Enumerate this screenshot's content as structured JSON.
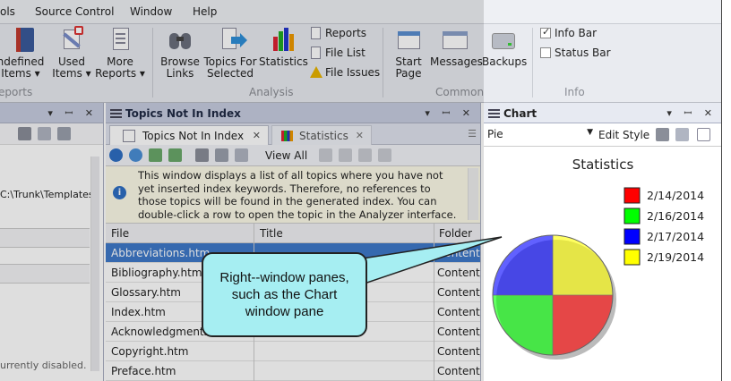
{
  "menubar": {
    "items": [
      "ols",
      "Source Control",
      "Window",
      "Help"
    ]
  },
  "ribbon": {
    "buttons": [
      {
        "line1": "ndefined",
        "line2": "Items ▾"
      },
      {
        "line1": "Used",
        "line2": "Items ▾"
      },
      {
        "line1": "More",
        "line2": "Reports ▾"
      },
      {
        "line1": "Browse",
        "line2": "Links"
      },
      {
        "line1": "Topics For",
        "line2": "Selected"
      },
      {
        "line1": "Statistics",
        "line2": ""
      },
      {
        "line1": "Start",
        "line2": "Page"
      },
      {
        "line1": "Messages",
        "line2": ""
      },
      {
        "line1": "Backups",
        "line2": ""
      }
    ],
    "small_items": [
      "Reports",
      "File List",
      "File Issues"
    ],
    "checkboxes": [
      {
        "label": "Info Bar",
        "checked": true
      },
      {
        "label": "Status Bar",
        "checked": false
      }
    ],
    "groups": [
      "eports",
      "Analysis",
      "Common",
      "Info"
    ]
  },
  "left_pane": {
    "path": "C:\\Trunk\\Templates\\",
    "status": "urrently disabled."
  },
  "topics_pane": {
    "title": "Topics Not In Index",
    "tabs": [
      {
        "label": "Topics Not In Index"
      },
      {
        "label": "Statistics"
      }
    ],
    "view_all": "View All",
    "info_text": "This window displays a list of all topics where you have not yet inserted index keywords. Therefore, no references to those topics will be found in the generated index. You can double-click a row to open the topic in the Analyzer interface. You can also select the row",
    "columns": [
      "File",
      "Title",
      "Folder"
    ],
    "rows": [
      {
        "file": "Abbreviations.htm",
        "folder": "Content/"
      },
      {
        "file": "Bibliography.htm",
        "folder": "Content/"
      },
      {
        "file": "Glossary.htm",
        "folder": "Content/"
      },
      {
        "file": "Index.htm",
        "folder": "Content/"
      },
      {
        "file": "Acknowledgments.htm",
        "folder": "Content/"
      },
      {
        "file": "Copyright.htm",
        "folder": "Content/"
      },
      {
        "file": "Preface.htm",
        "folder": "Content/"
      }
    ]
  },
  "chart_pane": {
    "title": "Chart",
    "chart_type_value": "Pie",
    "edit_style": "Edit Style"
  },
  "callout": {
    "text": "Right--window panes, such as the Chart window pane"
  },
  "chart_data": {
    "type": "pie",
    "title": "Statistics",
    "legend_position": "right",
    "slices": [
      {
        "label": "2/14/2014",
        "value": 25,
        "color": "#ff0000"
      },
      {
        "label": "2/16/2014",
        "value": 25,
        "color": "#00ff00"
      },
      {
        "label": "2/17/2014",
        "value": 25,
        "color": "#0000ff"
      },
      {
        "label": "2/19/2014",
        "value": 25,
        "color": "#ffff00"
      }
    ]
  }
}
